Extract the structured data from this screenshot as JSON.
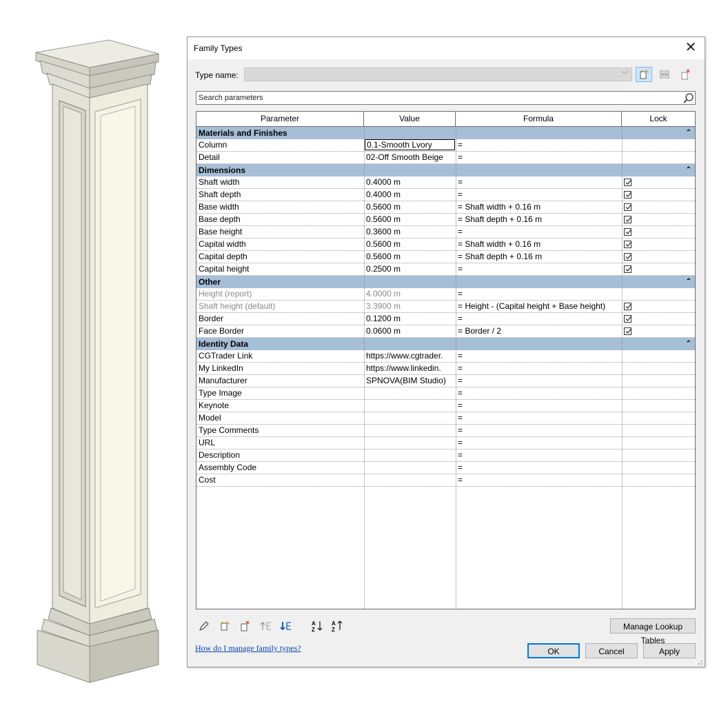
{
  "dialog": {
    "title": "Family Types",
    "type_name_label": "Type name:",
    "type_name_value": "",
    "search_placeholder": "Search parameters"
  },
  "columns": {
    "parameter": "Parameter",
    "value": "Value",
    "formula": "Formula",
    "lock": "Lock"
  },
  "groups": [
    {
      "name": "Materials and Finishes",
      "rows": [
        {
          "parameter": "Column",
          "value": "0.1-Smooth Lvory",
          "formula": "=",
          "lock": null,
          "editing": true
        },
        {
          "parameter": "Detail",
          "value": "02-Off Smooth Beige",
          "formula": "=",
          "lock": null
        }
      ]
    },
    {
      "name": "Dimensions",
      "rows": [
        {
          "parameter": "Shaft width",
          "value": "0.4000 m",
          "formula": "=",
          "lock": true
        },
        {
          "parameter": "Shaft depth",
          "value": "0.4000 m",
          "formula": "=",
          "lock": true
        },
        {
          "parameter": "Base width",
          "value": "0.5600 m",
          "formula": "= Shaft width + 0.16 m",
          "lock": true
        },
        {
          "parameter": "Base depth",
          "value": "0.5600 m",
          "formula": "= Shaft depth + 0.16 m",
          "lock": true
        },
        {
          "parameter": "Base height",
          "value": "0.3600 m",
          "formula": "=",
          "lock": true
        },
        {
          "parameter": "Capital width",
          "value": "0.5600 m",
          "formula": "= Shaft width + 0.16 m",
          "lock": true
        },
        {
          "parameter": "Capital depth",
          "value": "0.5600 m",
          "formula": "= Shaft depth + 0.16 m",
          "lock": true
        },
        {
          "parameter": "Capital height",
          "value": "0.2500 m",
          "formula": "=",
          "lock": true
        }
      ]
    },
    {
      "name": "Other",
      "rows": [
        {
          "parameter": "Height (report)",
          "value": "4.0000 m",
          "formula": "=",
          "lock": null,
          "greyed": true
        },
        {
          "parameter": "Shaft height (default)",
          "value": "3.3900 m",
          "formula": "= Height - (Capital height + Base height)",
          "lock": true,
          "greyed": true
        },
        {
          "parameter": "Border",
          "value": "0.1200 m",
          "formula": "=",
          "lock": true
        },
        {
          "parameter": "Face Border",
          "value": "0.0600 m",
          "formula": "= Border / 2",
          "lock": true
        }
      ]
    },
    {
      "name": "Identity Data",
      "rows": [
        {
          "parameter": "CGTrader Link",
          "value": "https://www.cgtrader.",
          "formula": "=",
          "lock": null
        },
        {
          "parameter": "My LinkedIn",
          "value": "https://www.linkedin.",
          "formula": "=",
          "lock": null
        },
        {
          "parameter": "Manufacturer",
          "value": "SPNOVA(BIM Studio)",
          "formula": "=",
          "lock": null
        },
        {
          "parameter": "Type Image",
          "value": "",
          "formula": "=",
          "lock": null
        },
        {
          "parameter": "Keynote",
          "value": "",
          "formula": "=",
          "lock": null
        },
        {
          "parameter": "Model",
          "value": "",
          "formula": "=",
          "lock": null
        },
        {
          "parameter": "Type Comments",
          "value": "",
          "formula": "=",
          "lock": null
        },
        {
          "parameter": "URL",
          "value": "",
          "formula": "=",
          "lock": null
        },
        {
          "parameter": "Description",
          "value": "",
          "formula": "=",
          "lock": null
        },
        {
          "parameter": "Assembly Code",
          "value": "",
          "formula": "=",
          "lock": null
        },
        {
          "parameter": "Cost",
          "value": "",
          "formula": "=",
          "lock": null
        }
      ]
    }
  ],
  "toolbar_icons": [
    "pencil-icon",
    "new-parameter-icon",
    "delete-parameter-icon",
    "move-up-icon",
    "move-down-icon",
    "sort-ascending-icon",
    "sort-descending-icon"
  ],
  "buttons": {
    "manage_lookup": "Manage Lookup Tables",
    "ok": "OK",
    "cancel": "Cancel",
    "apply": "Apply"
  },
  "help_link": "How do I manage family types?",
  "colors": {
    "group_header": "#a6bfd7",
    "link": "#0645ad",
    "accent": "#0078d7"
  }
}
